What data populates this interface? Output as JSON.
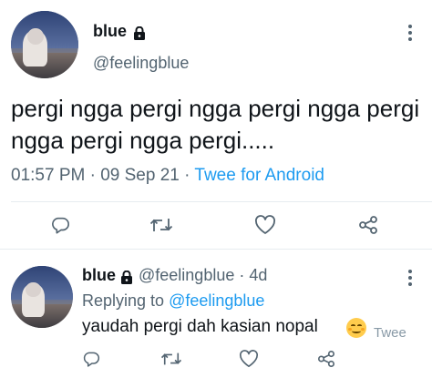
{
  "main_tweet": {
    "name": "blue",
    "handle": "@feelingblue",
    "text": "pergi ngga pergi ngga pergi ngga pergi ngga pergi ngga pergi.....",
    "time": "01:57 PM",
    "date": "09 Sep 21",
    "separator": "·",
    "source": "Twee for Android",
    "icons": [
      "lock-icon",
      "more-icon",
      "reply-icon",
      "retweet-icon",
      "like-icon",
      "share-icon"
    ]
  },
  "reply_tweet": {
    "name": "blue",
    "handle": "@feelingblue",
    "separator": "·",
    "age": "4d",
    "replying_prefix": "Replying to",
    "replying_to": "@feelingblue",
    "text": "yaudah pergi dah kasian nopal",
    "emoji": "smiling-face-icon",
    "source": "Twee",
    "icons": [
      "lock-icon",
      "more-icon",
      "reply-icon",
      "retweet-icon",
      "like-icon",
      "share-icon"
    ]
  },
  "colors": {
    "text": "#0f1419",
    "secondary": "#536471",
    "link": "#1d9bf0",
    "divider": "#e6ecf0"
  }
}
